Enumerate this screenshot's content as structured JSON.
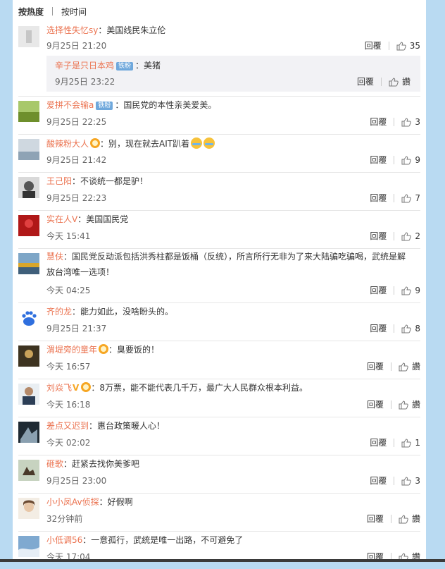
{
  "tabs": {
    "hot": "按热度",
    "time": "按时间"
  },
  "actions": {
    "reply": "回覆",
    "like_text": "讚"
  },
  "colors": {
    "page_bg": "#b9daf2",
    "username": "#eb7350",
    "fan_badge": "#6fa8dc",
    "subcomment_bg": "#f2f2f5"
  },
  "comments": [
    {
      "user": "选择性失忆sy",
      "text": "：美国线民朱立伦",
      "time": "9月25日 21:20",
      "likes": "35",
      "reply": {
        "user": "辛子是只日本鸡",
        "badge": "铁粉",
        "text": "：美猪",
        "time": "9月25日 23:22",
        "likes": "讚"
      }
    },
    {
      "user": "爱拼不会输a",
      "badge": "铁粉",
      "text": "：国民党的本性亲美爱美。",
      "time": "9月25日 22:25",
      "likes": "3"
    },
    {
      "user": "酸辣粉大人",
      "text": "：别，现在就去AIT趴着",
      "time": "9月25日 21:42",
      "likes": "9"
    },
    {
      "user": "王己阳",
      "text": "：不谈统一都是驴！",
      "time": "9月25日 22:23",
      "likes": "7"
    },
    {
      "user": "实在人V",
      "text": "：美国国民党",
      "time": "今天 15:41",
      "likes": "2"
    },
    {
      "user": "慧伕",
      "text": "：国民党反动派包括洪秀柱都是饭桶（反统），所言所行无非为了来大陆骗吃骗喝，武统是解放台湾唯一选项！",
      "time": "今天 04:25",
      "likes": "9"
    },
    {
      "user": "齐的龙",
      "text": "：能力如此，没啥盼头的。",
      "time": "9月25日 21:37",
      "likes": "8"
    },
    {
      "user": "渭堤旁的童年",
      "text": "：臭要饭的！",
      "time": "今天 16:57",
      "likes": "讚"
    },
    {
      "user": "刘焱飞",
      "text": "：8万票，能不能代表几千万，最广大人民群众根本利益。",
      "time": "今天 16:18",
      "likes": "讚"
    },
    {
      "user": "差点又迟到",
      "text": "：惠台政策暖人心！",
      "time": "今天 02:02",
      "likes": "1"
    },
    {
      "user": "砸歌",
      "text": "：赶紧去找你美爹吧",
      "time": "9月25日 23:00",
      "likes": "3"
    },
    {
      "user": "小小凤Av侦探",
      "text": "：好假啊",
      "time": "32分钟前",
      "likes": "讚"
    },
    {
      "user": "小低调56",
      "text": "：一意孤行，武统是唯一出路，不可避免了",
      "time": "今天 17:04",
      "likes": "讚"
    }
  ]
}
